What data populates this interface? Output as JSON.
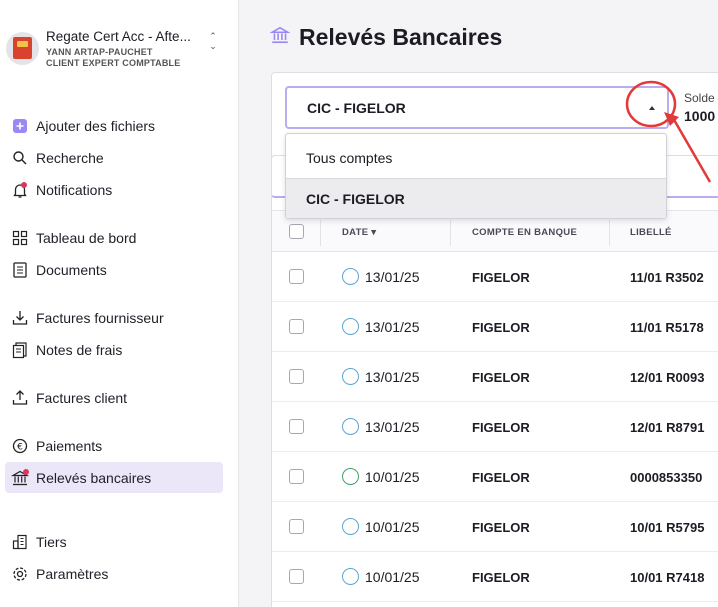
{
  "org": {
    "name": "Regate Cert Acc - Afte...",
    "line1": "YANN ARTAP-PAUCHET",
    "line2": "CLIENT EXPERT COMPTABLE"
  },
  "nav": {
    "add_files": "Ajouter des fichiers",
    "search": "Recherche",
    "notifications": "Notifications",
    "dashboard": "Tableau de bord",
    "documents": "Documents",
    "supplier_invoices": "Factures fournisseur",
    "expense_notes": "Notes de frais",
    "client_invoices": "Factures client",
    "payments": "Paiements",
    "bank_statements": "Relevés bancaires",
    "third_parties": "Tiers",
    "settings": "Paramètres"
  },
  "main": {
    "title": "Relevés Bancaires",
    "account_select": "CIC - FIGELOR",
    "solde_label": "Solde",
    "solde_value": "1000",
    "dropdown_options": [
      "Tous comptes",
      "CIC - FIGELOR"
    ]
  },
  "table": {
    "headers": {
      "date": "DATE",
      "bank": "COMPTE EN BANQUE",
      "label": "LIBELLÉ"
    },
    "rows": [
      {
        "date": "13/01/25",
        "bank": "FIGELOR",
        "label": "11/01 R3502"
      },
      {
        "date": "13/01/25",
        "bank": "FIGELOR",
        "label": "11/01 R5178"
      },
      {
        "date": "13/01/25",
        "bank": "FIGELOR",
        "label": "12/01 R0093"
      },
      {
        "date": "13/01/25",
        "bank": "FIGELOR",
        "label": "12/01 R8791"
      },
      {
        "date": "10/01/25",
        "bank": "FIGELOR",
        "label": "0000853350"
      },
      {
        "date": "10/01/25",
        "bank": "FIGELOR",
        "label": "10/01 R5795"
      },
      {
        "date": "10/01/25",
        "bank": "FIGELOR",
        "label": "10/01 R7418"
      }
    ]
  },
  "colors": {
    "accent": "#9b87f5",
    "active_bg": "#ebe7f8",
    "notification_dot": "#e0355b",
    "annotation": "#e23a3a"
  }
}
